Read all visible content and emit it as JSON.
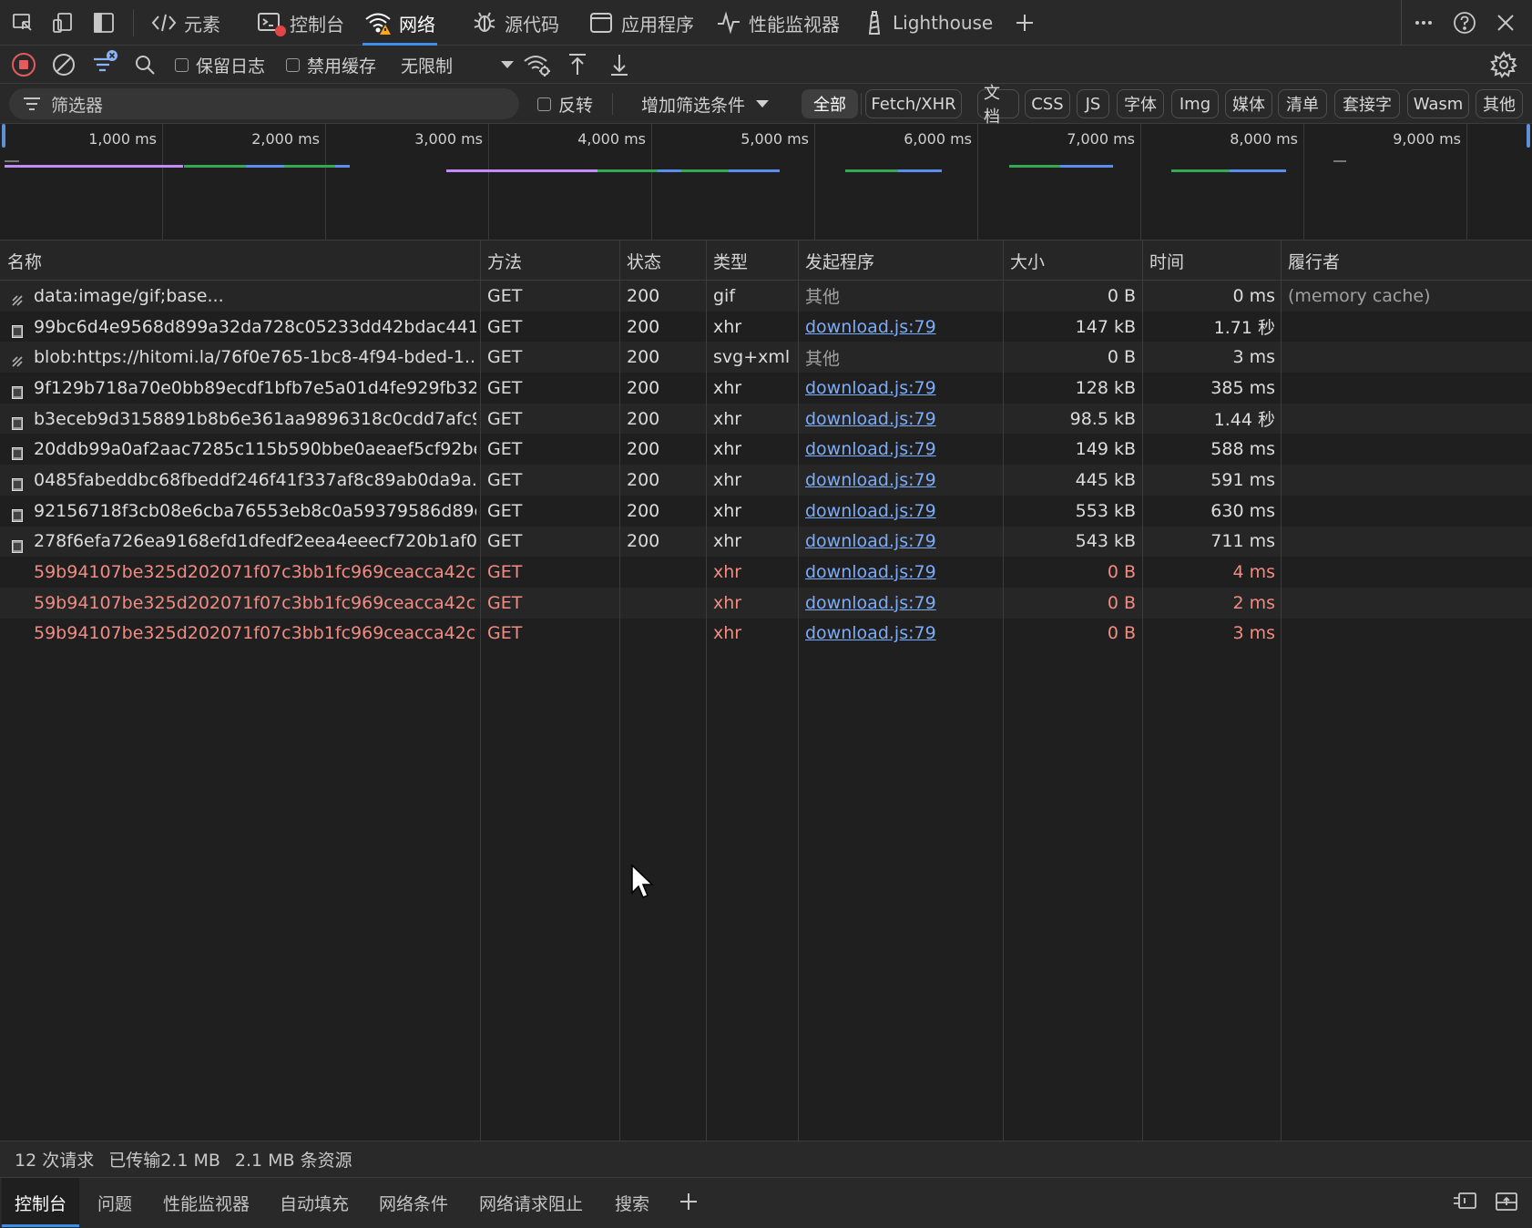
{
  "tabs": {
    "elements": "元素",
    "console": "控制台",
    "network": "网络",
    "sources": "源代码",
    "application": "应用程序",
    "performance": "性能监视器",
    "lighthouse": "Lighthouse"
  },
  "toolbar": {
    "preserve_log": "保留日志",
    "disable_cache": "禁用缓存",
    "throttling": "无限制"
  },
  "filter": {
    "placeholder": "筛选器",
    "invert": "反转",
    "more_filters": "增加筛选条件",
    "types": [
      "全部",
      "Fetch/XHR",
      "文档",
      "CSS",
      "JS",
      "字体",
      "Img",
      "媒体",
      "清单",
      "套接字",
      "Wasm",
      "其他"
    ]
  },
  "overview": {
    "ticks": [
      "1,000 ms",
      "2,000 ms",
      "3,000 ms",
      "4,000 ms",
      "5,000 ms",
      "6,000 ms",
      "7,000 ms",
      "8,000 ms",
      "9,000 ms"
    ]
  },
  "columns": {
    "name": "名称",
    "method": "方法",
    "status": "状态",
    "type": "类型",
    "initiator": "发起程序",
    "size": "大小",
    "time": "时间",
    "fulfilled": "履行者"
  },
  "rows": [
    {
      "name": "data:image/gif;base...",
      "method": "GET",
      "status": "200",
      "type": "gif",
      "initiator": "其他",
      "size": "0 B",
      "time": "0 ms",
      "fulfilled": "(memory cache)"
    },
    {
      "name": "99bc6d4e9568d899a32da728c05233dd42bdac441...",
      "method": "GET",
      "status": "200",
      "type": "xhr",
      "initiator": "download.js:79",
      "size": "147 kB",
      "time": "1.71 秒",
      "fulfilled": ""
    },
    {
      "name": "blob:https://hitomi.la/76f0e765-1bc8-4f94-bded-1...",
      "method": "GET",
      "status": "200",
      "type": "svg+xml",
      "initiator": "其他",
      "size": "0 B",
      "time": "3 ms",
      "fulfilled": ""
    },
    {
      "name": "9f129b718a70e0bb89ecdf1bfb7e5a01d4fe929fb32...",
      "method": "GET",
      "status": "200",
      "type": "xhr",
      "initiator": "download.js:79",
      "size": "128 kB",
      "time": "385 ms",
      "fulfilled": ""
    },
    {
      "name": "b3eceb9d3158891b8b6e361aa9896318c0cdd7afc9...",
      "method": "GET",
      "status": "200",
      "type": "xhr",
      "initiator": "download.js:79",
      "size": "98.5 kB",
      "time": "1.44 秒",
      "fulfilled": ""
    },
    {
      "name": "20ddb99a0af2aac7285c115b590bbe0aeaef5cf92be...",
      "method": "GET",
      "status": "200",
      "type": "xhr",
      "initiator": "download.js:79",
      "size": "149 kB",
      "time": "588 ms",
      "fulfilled": ""
    },
    {
      "name": "0485fabeddbc68fbeddf246f41f337af8c89ab0da9a...",
      "method": "GET",
      "status": "200",
      "type": "xhr",
      "initiator": "download.js:79",
      "size": "445 kB",
      "time": "591 ms",
      "fulfilled": ""
    },
    {
      "name": "92156718f3cb08e6cba76553eb8c0a59379586d89c...",
      "method": "GET",
      "status": "200",
      "type": "xhr",
      "initiator": "download.js:79",
      "size": "553 kB",
      "time": "630 ms",
      "fulfilled": ""
    },
    {
      "name": "278f6efa726ea9168efd1dfedf2eea4eeecf720b1af0...",
      "method": "GET",
      "status": "200",
      "type": "xhr",
      "initiator": "download.js:79",
      "size": "543 kB",
      "time": "711 ms",
      "fulfilled": ""
    },
    {
      "name": "59b94107be325d202071f07c3bb1fc969ceacca42cf...",
      "method": "GET",
      "status": "",
      "type": "xhr",
      "initiator": "download.js:79",
      "size": "0 B",
      "time": "4 ms",
      "fulfilled": "",
      "error": true
    },
    {
      "name": "59b94107be325d202071f07c3bb1fc969ceacca42cf...",
      "method": "GET",
      "status": "",
      "type": "xhr",
      "initiator": "download.js:79",
      "size": "0 B",
      "time": "2 ms",
      "fulfilled": "",
      "error": true
    },
    {
      "name": "59b94107be325d202071f07c3bb1fc969ceacca42cf...",
      "method": "GET",
      "status": "",
      "type": "xhr",
      "initiator": "download.js:79",
      "size": "0 B",
      "time": "3 ms",
      "fulfilled": "",
      "error": true
    }
  ],
  "status": {
    "requests": "12 次请求",
    "transferred": "已传输2.1 MB",
    "resources": "2.1 MB 条资源"
  },
  "drawer": {
    "tabs": [
      "控制台",
      "问题",
      "性能监视器",
      "自动填充",
      "网络条件",
      "网络请求阻止",
      "搜索"
    ]
  },
  "colors": {
    "accent": "#3b8eea",
    "error_text": "#f28b82",
    "link": "#7cacf8",
    "bar_purple": "#c58af9",
    "bar_green": "#34a853",
    "bar_blue": "#5b8def"
  }
}
